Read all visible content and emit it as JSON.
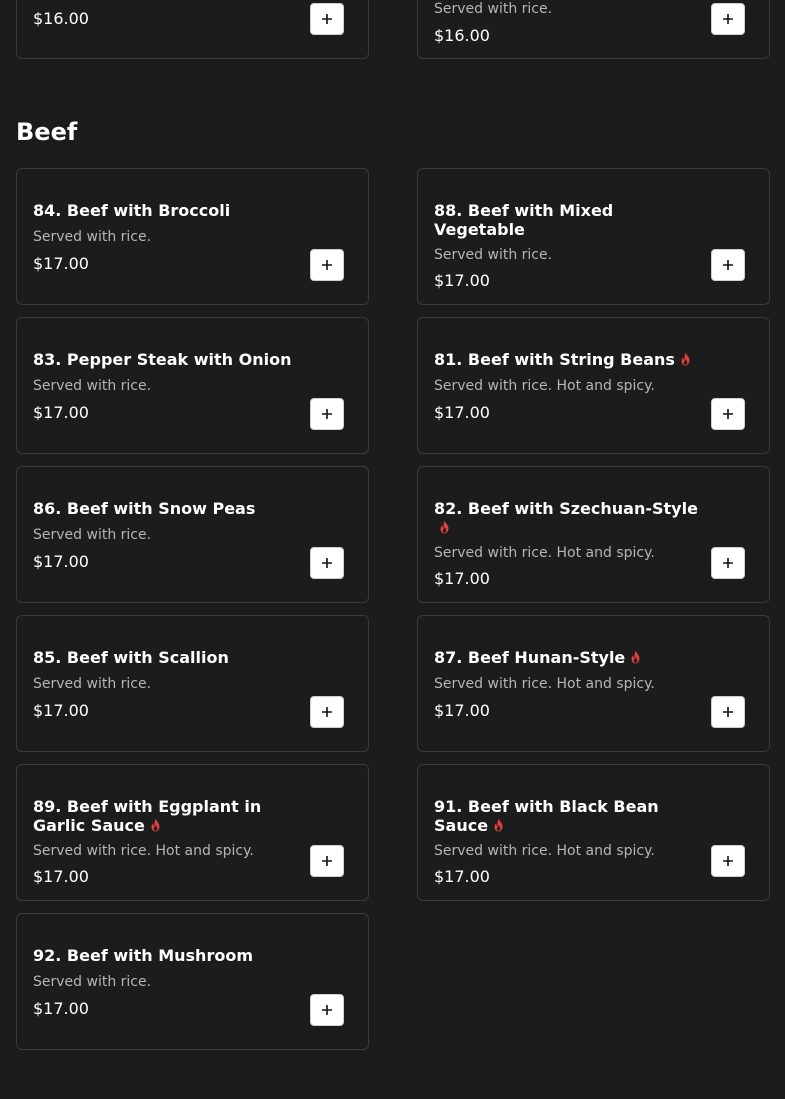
{
  "previous_section": {
    "items": [
      {
        "price": "$16.00"
      },
      {
        "description": "Served with rice.",
        "price": "$16.00"
      }
    ]
  },
  "section": {
    "title": "Beef",
    "items": [
      {
        "name": "84. Beef with Broccoli",
        "description": "Served with rice.",
        "price": "$17.00",
        "spicy": false
      },
      {
        "name": "88. Beef with Mixed Vegetable",
        "description": "Served with rice.",
        "price": "$17.00",
        "spicy": false
      },
      {
        "name": "83. Pepper Steak with Onion",
        "description": "Served with rice.",
        "price": "$17.00",
        "spicy": false
      },
      {
        "name": "81. Beef with String Beans",
        "description": "Served with rice. Hot and spicy.",
        "price": "$17.00",
        "spicy": true
      },
      {
        "name": "86. Beef with Snow Peas",
        "description": "Served with rice.",
        "price": "$17.00",
        "spicy": false
      },
      {
        "name": "82. Beef with Szechuan-Style",
        "description": "Served with rice. Hot and spicy.",
        "price": "$17.00",
        "spicy": true
      },
      {
        "name": "85. Beef with Scallion",
        "description": "Served with rice.",
        "price": "$17.00",
        "spicy": false
      },
      {
        "name": "87. Beef Hunan-Style",
        "description": "Served with rice. Hot and spicy.",
        "price": "$17.00",
        "spicy": true
      },
      {
        "name": "89. Beef with Eggplant in Garlic Sauce",
        "description": "Served with rice. Hot and spicy.",
        "price": "$17.00",
        "spicy": true
      },
      {
        "name": "91. Beef with Black Bean Sauce",
        "description": "Served with rice. Hot and spicy.",
        "price": "$17.00",
        "spicy": true
      },
      {
        "name": "92. Beef with Mushroom",
        "description": "Served with rice.",
        "price": "$17.00",
        "spicy": false
      }
    ]
  },
  "icons": {
    "add": "plus-icon",
    "spicy": "flame-icon"
  },
  "colors": {
    "background": "#1c1c1c",
    "card_border": "#3a3a3a",
    "spicy": "#e0403a",
    "description": "#b5b5b5"
  }
}
